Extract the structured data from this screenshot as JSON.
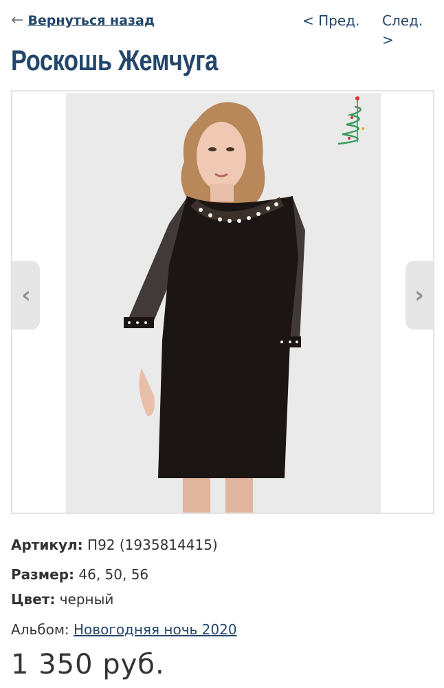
{
  "nav": {
    "back_arrow": "←",
    "back_label": "Вернуться назад",
    "prev_label": "< Пред.",
    "next_label": "След. >"
  },
  "product": {
    "title": "Роскошь Жемчуга",
    "article_label": "Артикул:",
    "article_value": "П92 (1935814415)",
    "size_label": "Размер:",
    "size_value": "46, 50, 56",
    "color_label": "Цвет:",
    "color_value": "черный",
    "album_label": "Альбом:",
    "album_value": "Новогодняя ночь 2020",
    "price": "1 350 руб."
  },
  "gallery": {
    "left_arrow_icon": "chevron-left-icon",
    "right_arrow_icon": "chevron-right-icon",
    "left_glyph": "‹",
    "right_glyph": "›"
  },
  "colors": {
    "link": "#23466b",
    "text": "#333333",
    "dress": "#1b1513"
  }
}
